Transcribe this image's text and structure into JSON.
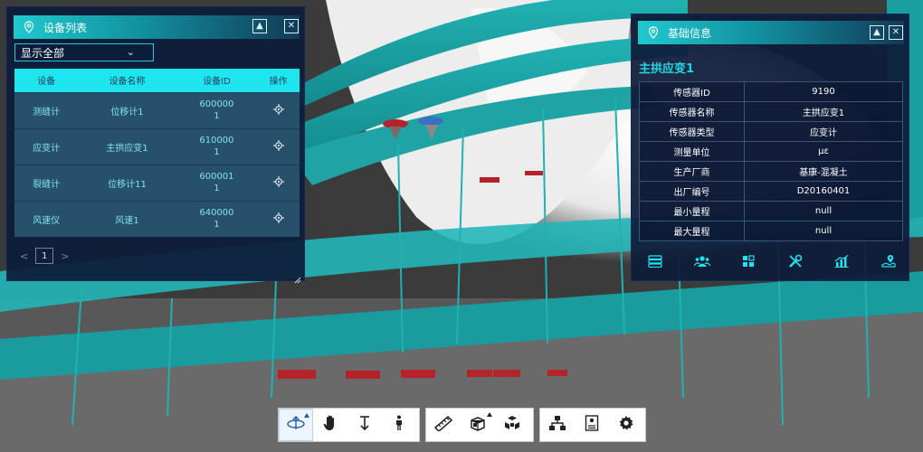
{
  "colors": {
    "accent": "#1fe6ee",
    "teal_bridge": "#1aa7a8",
    "panel_bg": "#0e1c3a",
    "header_start": "#1fc9d0",
    "table_row": "#27506a",
    "row_text": "#7fe3ea",
    "info_title": "#1fd8e2",
    "sensor_red": "#b4222a",
    "sensor_blue": "#3b6fc4"
  },
  "device_panel": {
    "title": "设备列表",
    "filter_value": "显示全部",
    "columns": [
      "设备",
      "设备名称",
      "设备ID",
      "操作"
    ],
    "rows": [
      {
        "device": "测缝计",
        "name": "位移计1",
        "id_line1": "600000",
        "id_line2": "1"
      },
      {
        "device": "应变计",
        "name": "主拱应变1",
        "id_line1": "610000",
        "id_line2": "1"
      },
      {
        "device": "裂缝计",
        "name": "位移计11",
        "id_line1": "600001",
        "id_line2": "1"
      },
      {
        "device": "风速仪",
        "name": "风速1",
        "id_line1": "640000",
        "id_line2": "1"
      }
    ],
    "pager": {
      "prev": "<",
      "page": "1",
      "next": ">"
    },
    "icons": {
      "pin": "location-pin-icon",
      "collapse": "triangle-up-icon",
      "close": "close-icon",
      "locate": "crosshair-icon"
    }
  },
  "info_panel": {
    "title": "基础信息",
    "heading": "主拱应变1",
    "rows": [
      {
        "label": "传感器ID",
        "value": "9190"
      },
      {
        "label": "传感器名称",
        "value": "主拱应变1"
      },
      {
        "label": "传感器类型",
        "value": "应变计"
      },
      {
        "label": "测量单位",
        "value": "με"
      },
      {
        "label": "生产厂商",
        "value": "基康-混凝土"
      },
      {
        "label": "出厂编号",
        "value": "D20160401"
      },
      {
        "label": "最小量程",
        "value": "null"
      },
      {
        "label": "最大量程",
        "value": "null"
      }
    ],
    "toolbar_icons": [
      "server-icon",
      "users-icon",
      "modules-icon",
      "tools-icon",
      "chart-icon",
      "map-location-icon"
    ]
  },
  "bottom_toolbar": {
    "group1": [
      "orbit-icon",
      "pan-hand-icon",
      "vertical-move-icon",
      "walk-person-icon"
    ],
    "group2": [
      "measure-ruler-icon",
      "section-box-icon",
      "explode-cubes-icon"
    ],
    "group3": [
      "model-tree-icon",
      "properties-icon",
      "settings-gear-icon"
    ]
  }
}
